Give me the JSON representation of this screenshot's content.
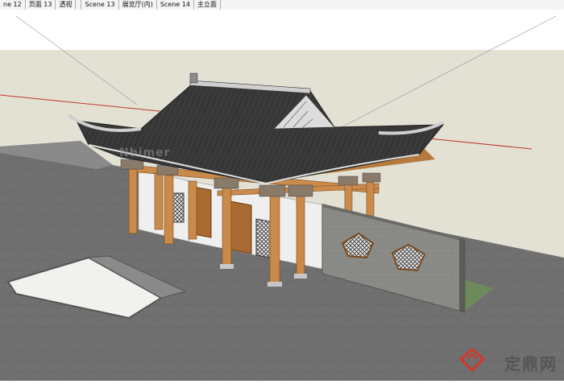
{
  "tabs": [
    {
      "label": "ne 12"
    },
    {
      "label": "页面 13"
    },
    {
      "label": "透视"
    },
    {
      "label": "Scene 13"
    },
    {
      "label": "展览厅(内)"
    },
    {
      "label": "Scene 14"
    },
    {
      "label": "主立面"
    }
  ],
  "watermark": "Nbimer",
  "logo_text": "定鼎网",
  "colors": {
    "sky": "#ffffff",
    "ground": "#e3e0d4",
    "plaza": "#6f6f6f",
    "roof": "#3b3b3b",
    "wood": "#c98a4a",
    "wall": "#efefef",
    "screen_wall": "#8a8a86",
    "axis_red": "#c0392b",
    "logo_red": "#d9342b"
  }
}
